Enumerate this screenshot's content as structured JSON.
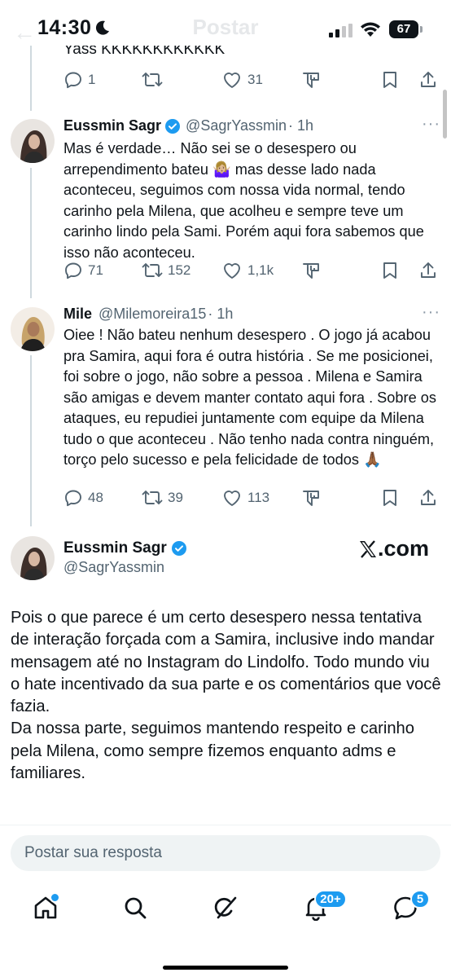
{
  "status_bar": {
    "time": "14:30",
    "battery": "67",
    "ghost_title": "Postar"
  },
  "clipped_prev_text": "Yass KKKKKKKKKKKK",
  "prev_actions": {
    "reply": "1",
    "retweet": "",
    "like": "31"
  },
  "replies": [
    {
      "name": "Eussmin Sagr",
      "handle": "@SagrYassmin",
      "time": "· 1h",
      "text": "Mas é verdade… Não sei se o desespero ou arrependimento bateu 🤷🏼‍♀️ mas desse lado nada aconteceu, seguimos com nossa vida normal, tendo carinho pela Milena, que acolheu e sempre teve um carinho lindo pela Sami. Porém aqui fora sabemos que isso não aconteceu.",
      "reply_count": "71",
      "retweet_count": "152",
      "like_count": "1,1k"
    },
    {
      "name": "Mile",
      "handle": "@Milemoreira15",
      "time": "· 1h",
      "text": "Oiee ! Não bateu nenhum desespero . O jogo já acabou pra Samira, aqui fora é outra história . Se me posicionei, foi sobre o jogo, não sobre a pessoa . Milena e Samira são amigas e devem manter contato aqui fora . Sobre os ataques, eu repudiei juntamente com equipe da Milena tudo o que aconteceu . Não tenho nada contra ninguém, torço pelo sucesso e pela felicidade de todos 🙏🏾",
      "reply_count": "48",
      "retweet_count": "39",
      "like_count": "113"
    }
  ],
  "main_tweet": {
    "name": "Eussmin Sagr",
    "handle": "@SagrYassmin",
    "brand": ".com",
    "text": "Pois o que parece é um certo desespero nessa tentativa de interação forçada com a Samira, inclusive indo mandar mensagem até no Instagram do Lindolfo. Todo mundo viu o hate incentivado da sua parte e os comentários que você fazia.\nDa nossa parte, seguimos mantendo respeito e carinho pela Milena, como sempre fizemos enquanto adms e familiares."
  },
  "reply_input": {
    "placeholder": "Postar sua resposta"
  },
  "nav": {
    "notifications_badge": "20+",
    "messages_badge": "5"
  },
  "colors": {
    "accent": "#1d9bf0",
    "text": "#0f1419",
    "secondary": "#536471"
  },
  "icons": [
    "reply-icon",
    "retweet-icon",
    "like-icon",
    "analytics-icon",
    "bookmark-icon",
    "share-icon",
    "verified-icon",
    "home-icon",
    "search-icon",
    "grok-icon",
    "bell-icon",
    "messages-icon"
  ]
}
